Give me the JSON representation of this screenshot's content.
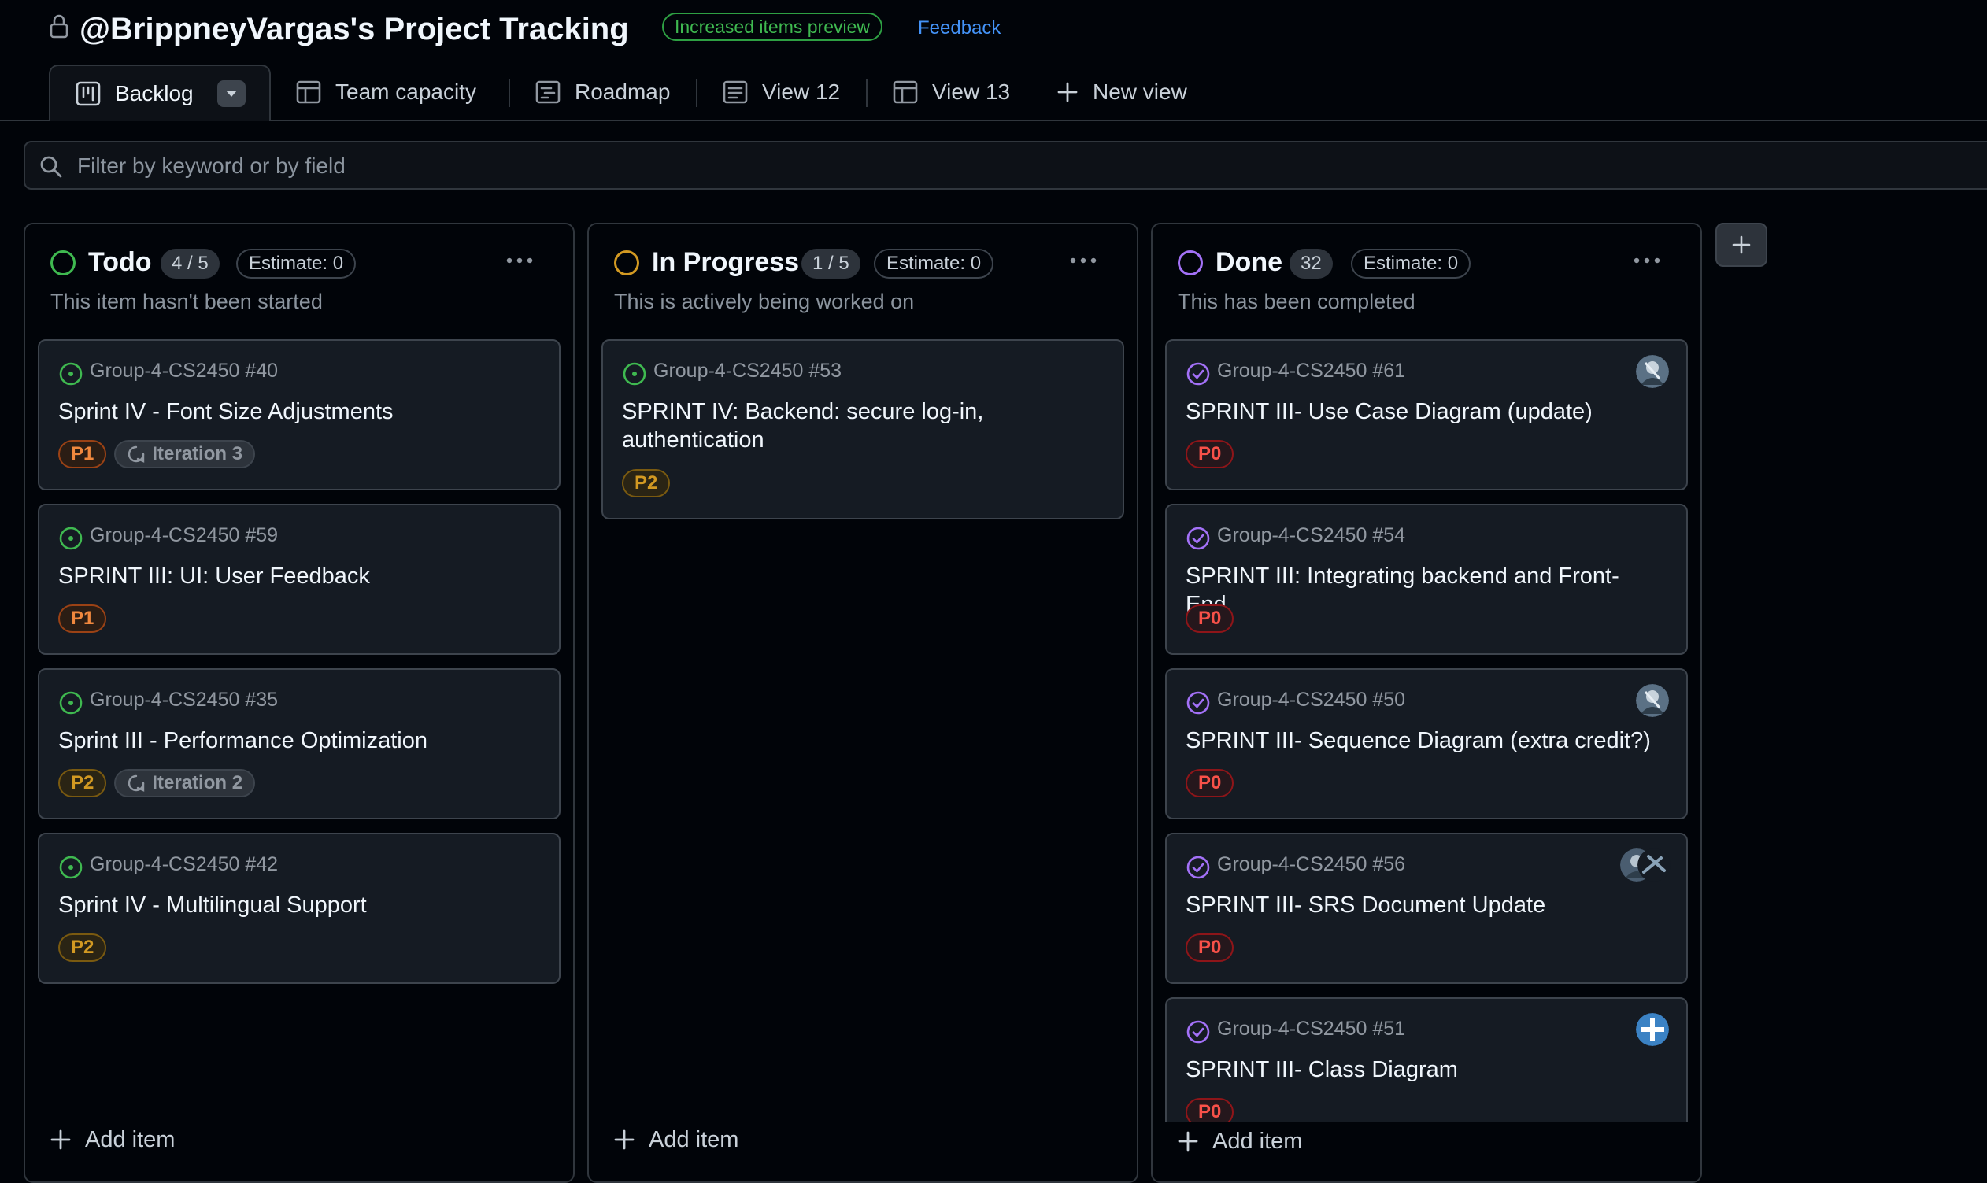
{
  "header": {
    "title": "@BrippneyVargas's Project Tracking",
    "preview_badge": "Increased items preview",
    "feedback": "Feedback"
  },
  "tabs": [
    {
      "label": "Backlog",
      "icon": "board-icon",
      "active": true
    },
    {
      "label": "Team capacity",
      "icon": "table-icon"
    },
    {
      "label": "Roadmap",
      "icon": "roadmap-icon"
    },
    {
      "label": "View 12",
      "icon": "list-icon"
    },
    {
      "label": "View 13",
      "icon": "table-icon"
    },
    {
      "label": "New view",
      "icon": "plus-icon"
    }
  ],
  "filter": {
    "placeholder": "Filter by keyword or by field"
  },
  "colors": {
    "todo": "#3fb950",
    "in_progress": "#d29922",
    "done": "#a371f7",
    "open_issue": "#3fb950",
    "closed_issue": "#a371f7"
  },
  "columns": [
    {
      "name": "Todo",
      "count": "4 / 5",
      "estimate": "Estimate: 0",
      "description": "This item hasn't been started",
      "add_item": "Add item",
      "cards": [
        {
          "ref": "Group-4-CS2450 #40",
          "title": "Sprint IV - Font Size Adjustments",
          "priority": "P1",
          "iteration": "Iteration 3"
        },
        {
          "ref": "Group-4-CS2450 #59",
          "title": "SPRINT III: UI: User Feedback",
          "priority": "P1"
        },
        {
          "ref": "Group-4-CS2450 #35",
          "title": "Sprint III - Performance Optimization",
          "priority": "P2",
          "iteration": "Iteration 2"
        },
        {
          "ref": "Group-4-CS2450 #42",
          "title": "Sprint IV - Multilingual Support",
          "priority": "P2"
        }
      ]
    },
    {
      "name": "In Progress",
      "count": "1 / 5",
      "estimate": "Estimate: 0",
      "description": "This is actively being worked on",
      "add_item": "Add item",
      "cards": [
        {
          "ref": "Group-4-CS2450 #53",
          "title": "SPRINT IV: Backend: secure log-in, authentication",
          "priority": "P2"
        }
      ]
    },
    {
      "name": "Done",
      "count": "32",
      "estimate": "Estimate: 0",
      "description": "This has been completed",
      "add_item": "Add item",
      "cards": [
        {
          "ref": "Group-4-CS2450 #61",
          "title": "SPRINT III- Use Case Diagram (update)",
          "priority": "P0"
        },
        {
          "ref": "Group-4-CS2450 #54",
          "title": "SPRINT III: Integrating backend and Front-End",
          "priority": "P0"
        },
        {
          "ref": "Group-4-CS2450 #50",
          "title": "SPRINT III- Sequence Diagram (extra credit?)",
          "priority": "P0"
        },
        {
          "ref": "Group-4-CS2450 #56",
          "title": "SPRINT III- SRS Document Update",
          "priority": "P0"
        },
        {
          "ref": "Group-4-CS2450 #51",
          "title": "SPRINT III- Class Diagram",
          "priority": "P0"
        }
      ]
    }
  ]
}
